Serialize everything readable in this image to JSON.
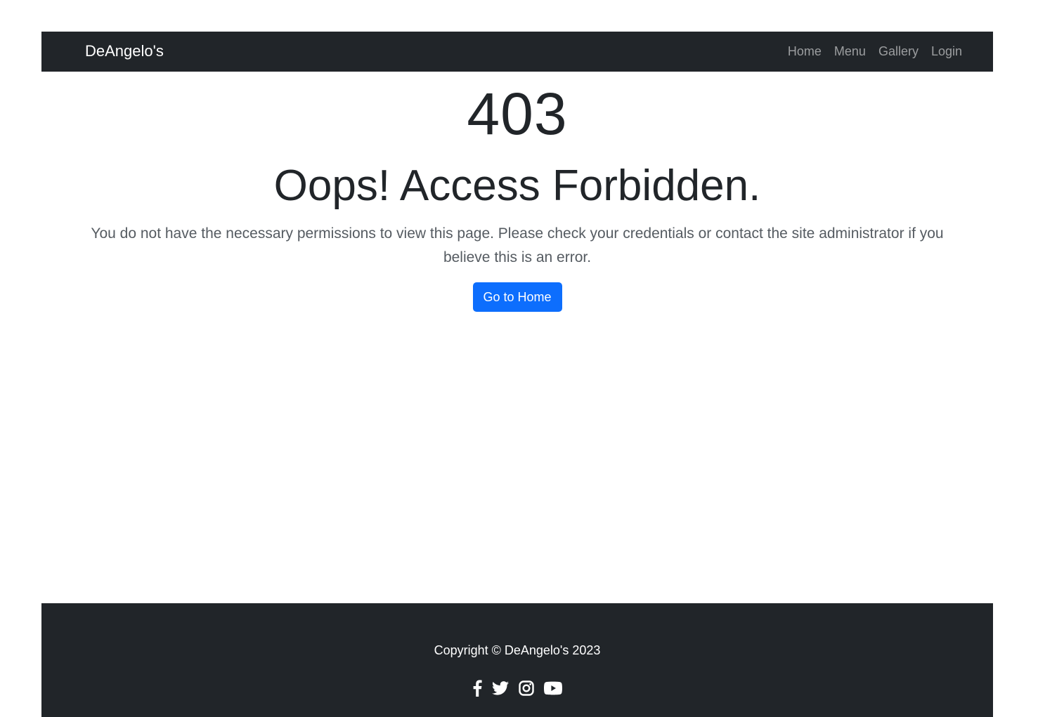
{
  "navbar": {
    "brand": "DeAngelo's",
    "links": [
      "Home",
      "Menu",
      "Gallery",
      "Login"
    ]
  },
  "main": {
    "code": "403",
    "headline": "Oops! Access Forbidden.",
    "message": "You do not have the necessary permissions to view this page. Please check your credentials or contact the site administrator if you believe this is an error.",
    "button_label": "Go to Home"
  },
  "footer": {
    "copyright": "Copyright © DeAngelo's 2023",
    "social_icons": [
      "facebook-icon",
      "twitter-icon",
      "instagram-icon",
      "youtube-icon"
    ]
  },
  "colors": {
    "navbar_bg": "#212529",
    "primary": "#0d6efd",
    "text": "#212529"
  }
}
